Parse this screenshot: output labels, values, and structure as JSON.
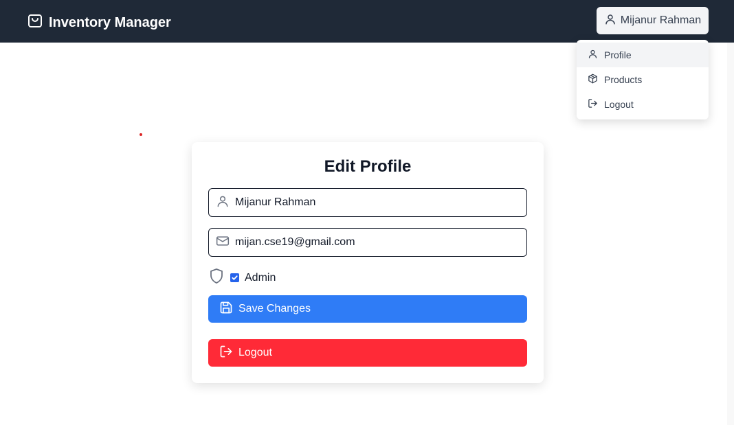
{
  "app": {
    "title": "Inventory Manager",
    "logo_icon": "shopping-bag-icon"
  },
  "user_menu": {
    "name": "Mijanur Rahman",
    "icon": "user-icon",
    "items": [
      {
        "label": "Profile",
        "icon": "user-icon",
        "active": true
      },
      {
        "label": "Products",
        "icon": "package-icon",
        "active": false
      },
      {
        "label": "Logout",
        "icon": "logout-icon",
        "active": false
      }
    ]
  },
  "profile_form": {
    "title": "Edit Profile",
    "name_value": "Mijanur Rahman",
    "email_value": "mijan.cse19@gmail.com",
    "admin_label": "Admin",
    "admin_checked": true,
    "save_label": "Save Changes",
    "logout_label": "Logout"
  },
  "colors": {
    "navbar": "#1f2937",
    "primary": "#2f7cf6",
    "danger": "#ff2a37",
    "checkbox": "#2563eb"
  }
}
